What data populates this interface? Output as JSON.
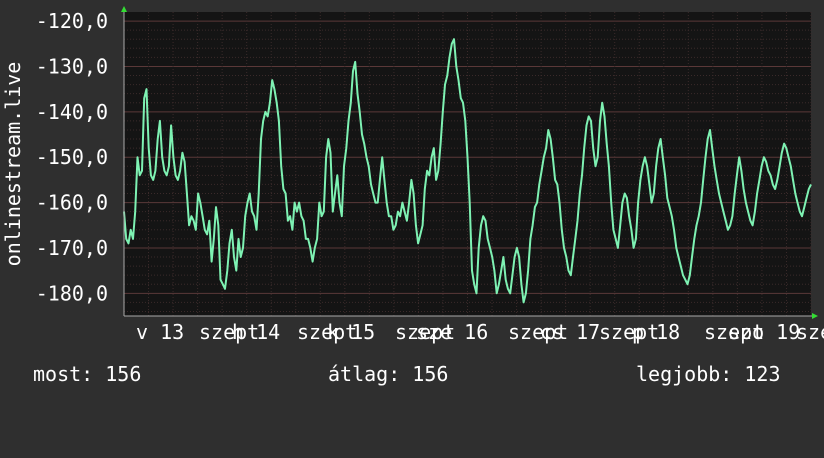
{
  "chart_data": {
    "type": "line",
    "ylabel": "onlinestream.live",
    "ylim": [
      -185,
      -118
    ],
    "y_ticks": [
      -120,
      -130,
      -140,
      -150,
      -160,
      -170,
      -180
    ],
    "y_tick_labels": [
      "-120,0",
      "-130,0",
      "-140,0",
      "-150,0",
      "-160,0",
      "-170,0",
      "-180,0"
    ],
    "x_tick_labels": [
      "v 13",
      "szept",
      "h 14",
      "szept",
      "k 15",
      "szept",
      "sze 16",
      "szept",
      "cs 17",
      "szept",
      "p 18",
      "szept",
      "szo 19",
      "szept"
    ],
    "grid": true,
    "series": [
      {
        "color": "#7ef2b3",
        "values": [
          -162,
          -168,
          -169,
          -166,
          -168,
          -162,
          -150,
          -154,
          -153,
          -137,
          -135,
          -148,
          -154,
          -155,
          -153,
          -146,
          -142,
          -150,
          -153,
          -154,
          -152,
          -143,
          -150,
          -154,
          -155,
          -153,
          -149,
          -151,
          -158,
          -165,
          -163,
          -164,
          -166,
          -158,
          -160,
          -163,
          -166,
          -167,
          -164,
          -173,
          -168,
          -161,
          -165,
          -177,
          -178,
          -179,
          -175,
          -169,
          -166,
          -172,
          -175,
          -168,
          -172,
          -170,
          -163,
          -160,
          -158,
          -162,
          -163,
          -166,
          -158,
          -146,
          -142,
          -140,
          -141,
          -138,
          -133,
          -135,
          -138,
          -142,
          -152,
          -157,
          -158,
          -164,
          -163,
          -166,
          -160,
          -162,
          -160,
          -163,
          -164,
          -168,
          -168,
          -170,
          -173,
          -170,
          -168,
          -160,
          -163,
          -162,
          -150,
          -146,
          -149,
          -162,
          -158,
          -154,
          -160,
          -163,
          -152,
          -148,
          -142,
          -138,
          -131,
          -129,
          -136,
          -140,
          -145,
          -147,
          -150,
          -152,
          -156,
          -158,
          -160,
          -160,
          -155,
          -150,
          -155,
          -160,
          -163,
          -163,
          -166,
          -165,
          -162,
          -163,
          -160,
          -162,
          -164,
          -160,
          -155,
          -158,
          -165,
          -169,
          -167,
          -165,
          -157,
          -153,
          -154,
          -150,
          -148,
          -155,
          -153,
          -147,
          -140,
          -134,
          -132,
          -128,
          -125,
          -124,
          -130,
          -133,
          -137,
          -138,
          -142,
          -150,
          -160,
          -175,
          -178,
          -180,
          -170,
          -165,
          -163,
          -164,
          -168,
          -170,
          -172,
          -175,
          -180,
          -178,
          -175,
          -172,
          -177,
          -179,
          -180,
          -176,
          -172,
          -170,
          -172,
          -178,
          -182,
          -180,
          -175,
          -168,
          -165,
          -161,
          -160,
          -156,
          -153,
          -150,
          -148,
          -144,
          -146,
          -150,
          -155,
          -156,
          -160,
          -166,
          -170,
          -172,
          -175,
          -176,
          -172,
          -168,
          -164,
          -158,
          -154,
          -148,
          -143,
          -141,
          -142,
          -148,
          -152,
          -150,
          -142,
          -138,
          -141,
          -147,
          -152,
          -160,
          -166,
          -168,
          -170,
          -165,
          -160,
          -158,
          -159,
          -163,
          -166,
          -170,
          -168,
          -160,
          -155,
          -152,
          -150,
          -152,
          -156,
          -160,
          -158,
          -152,
          -148,
          -146,
          -150,
          -154,
          -159,
          -161,
          -163,
          -166,
          -170,
          -172,
          -174,
          -176,
          -177,
          -178,
          -176,
          -172,
          -168,
          -165,
          -163,
          -160,
          -155,
          -150,
          -146,
          -144,
          -148,
          -152,
          -155,
          -158,
          -160,
          -162,
          -164,
          -166,
          -165,
          -163,
          -158,
          -154,
          -150,
          -153,
          -157,
          -160,
          -162,
          -164,
          -165,
          -162,
          -158,
          -155,
          -152,
          -150,
          -151,
          -153,
          -154,
          -156,
          -157,
          -155,
          -152,
          -149,
          -147,
          -148,
          -150,
          -152,
          -155,
          -158,
          -160,
          -162,
          -163,
          -161,
          -159,
          -157,
          -156
        ]
      }
    ]
  },
  "stats": {
    "now": "most: 156",
    "avg": "átlag: 156",
    "best": "legjobb: 123"
  }
}
